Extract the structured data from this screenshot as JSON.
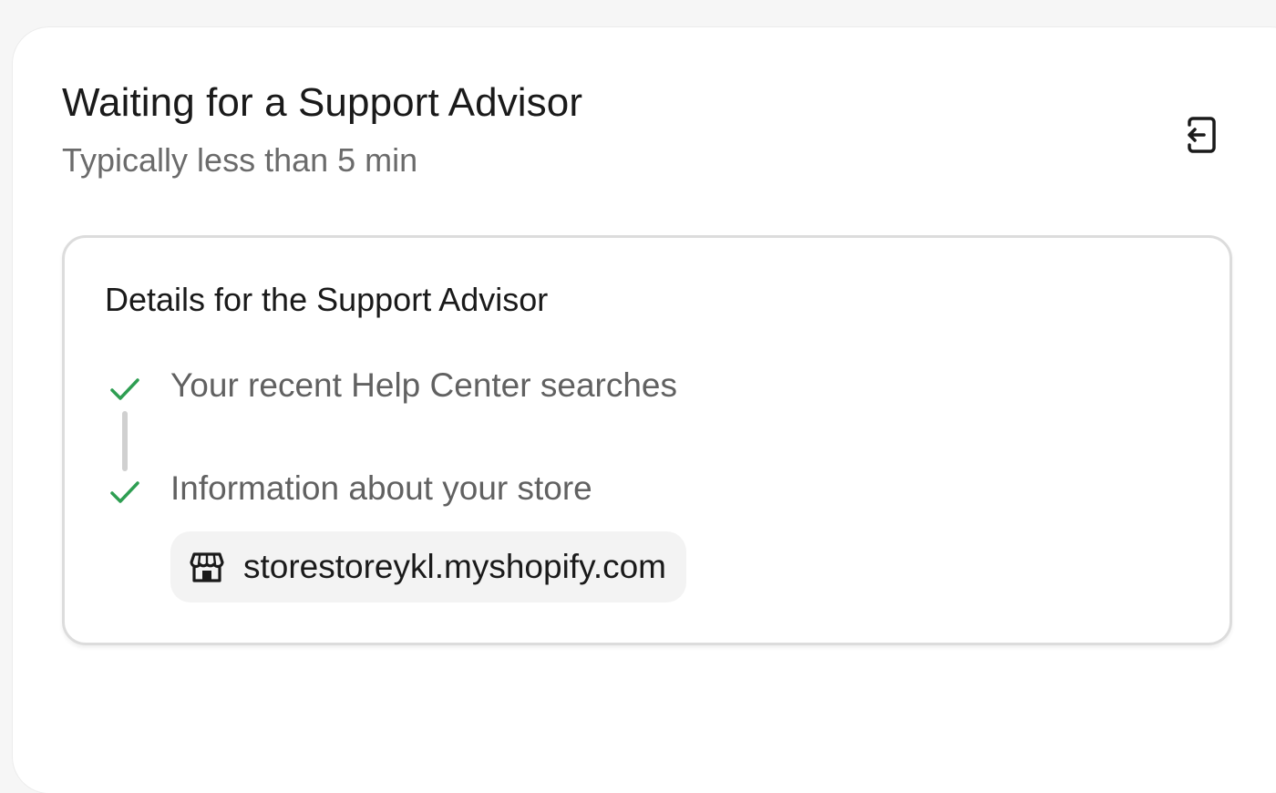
{
  "header": {
    "title": "Waiting for a Support Advisor",
    "subtitle": "Typically less than 5 min",
    "exit_icon": "exit-icon"
  },
  "details": {
    "title": "Details for the Support Advisor",
    "steps": [
      {
        "label": "Your recent Help Center searches",
        "icon": "checkmark-icon",
        "status": "complete"
      },
      {
        "label": "Information about your store",
        "icon": "checkmark-icon",
        "status": "complete"
      }
    ],
    "store": {
      "icon": "store-icon",
      "url": "storestoreykl.myshopify.com"
    }
  },
  "colors": {
    "check": "#2e9e52",
    "text_primary": "#1a1a1a",
    "text_secondary": "#6b6b6b",
    "card_border": "#dcdcdc",
    "chip_background": "#f3f3f3"
  }
}
